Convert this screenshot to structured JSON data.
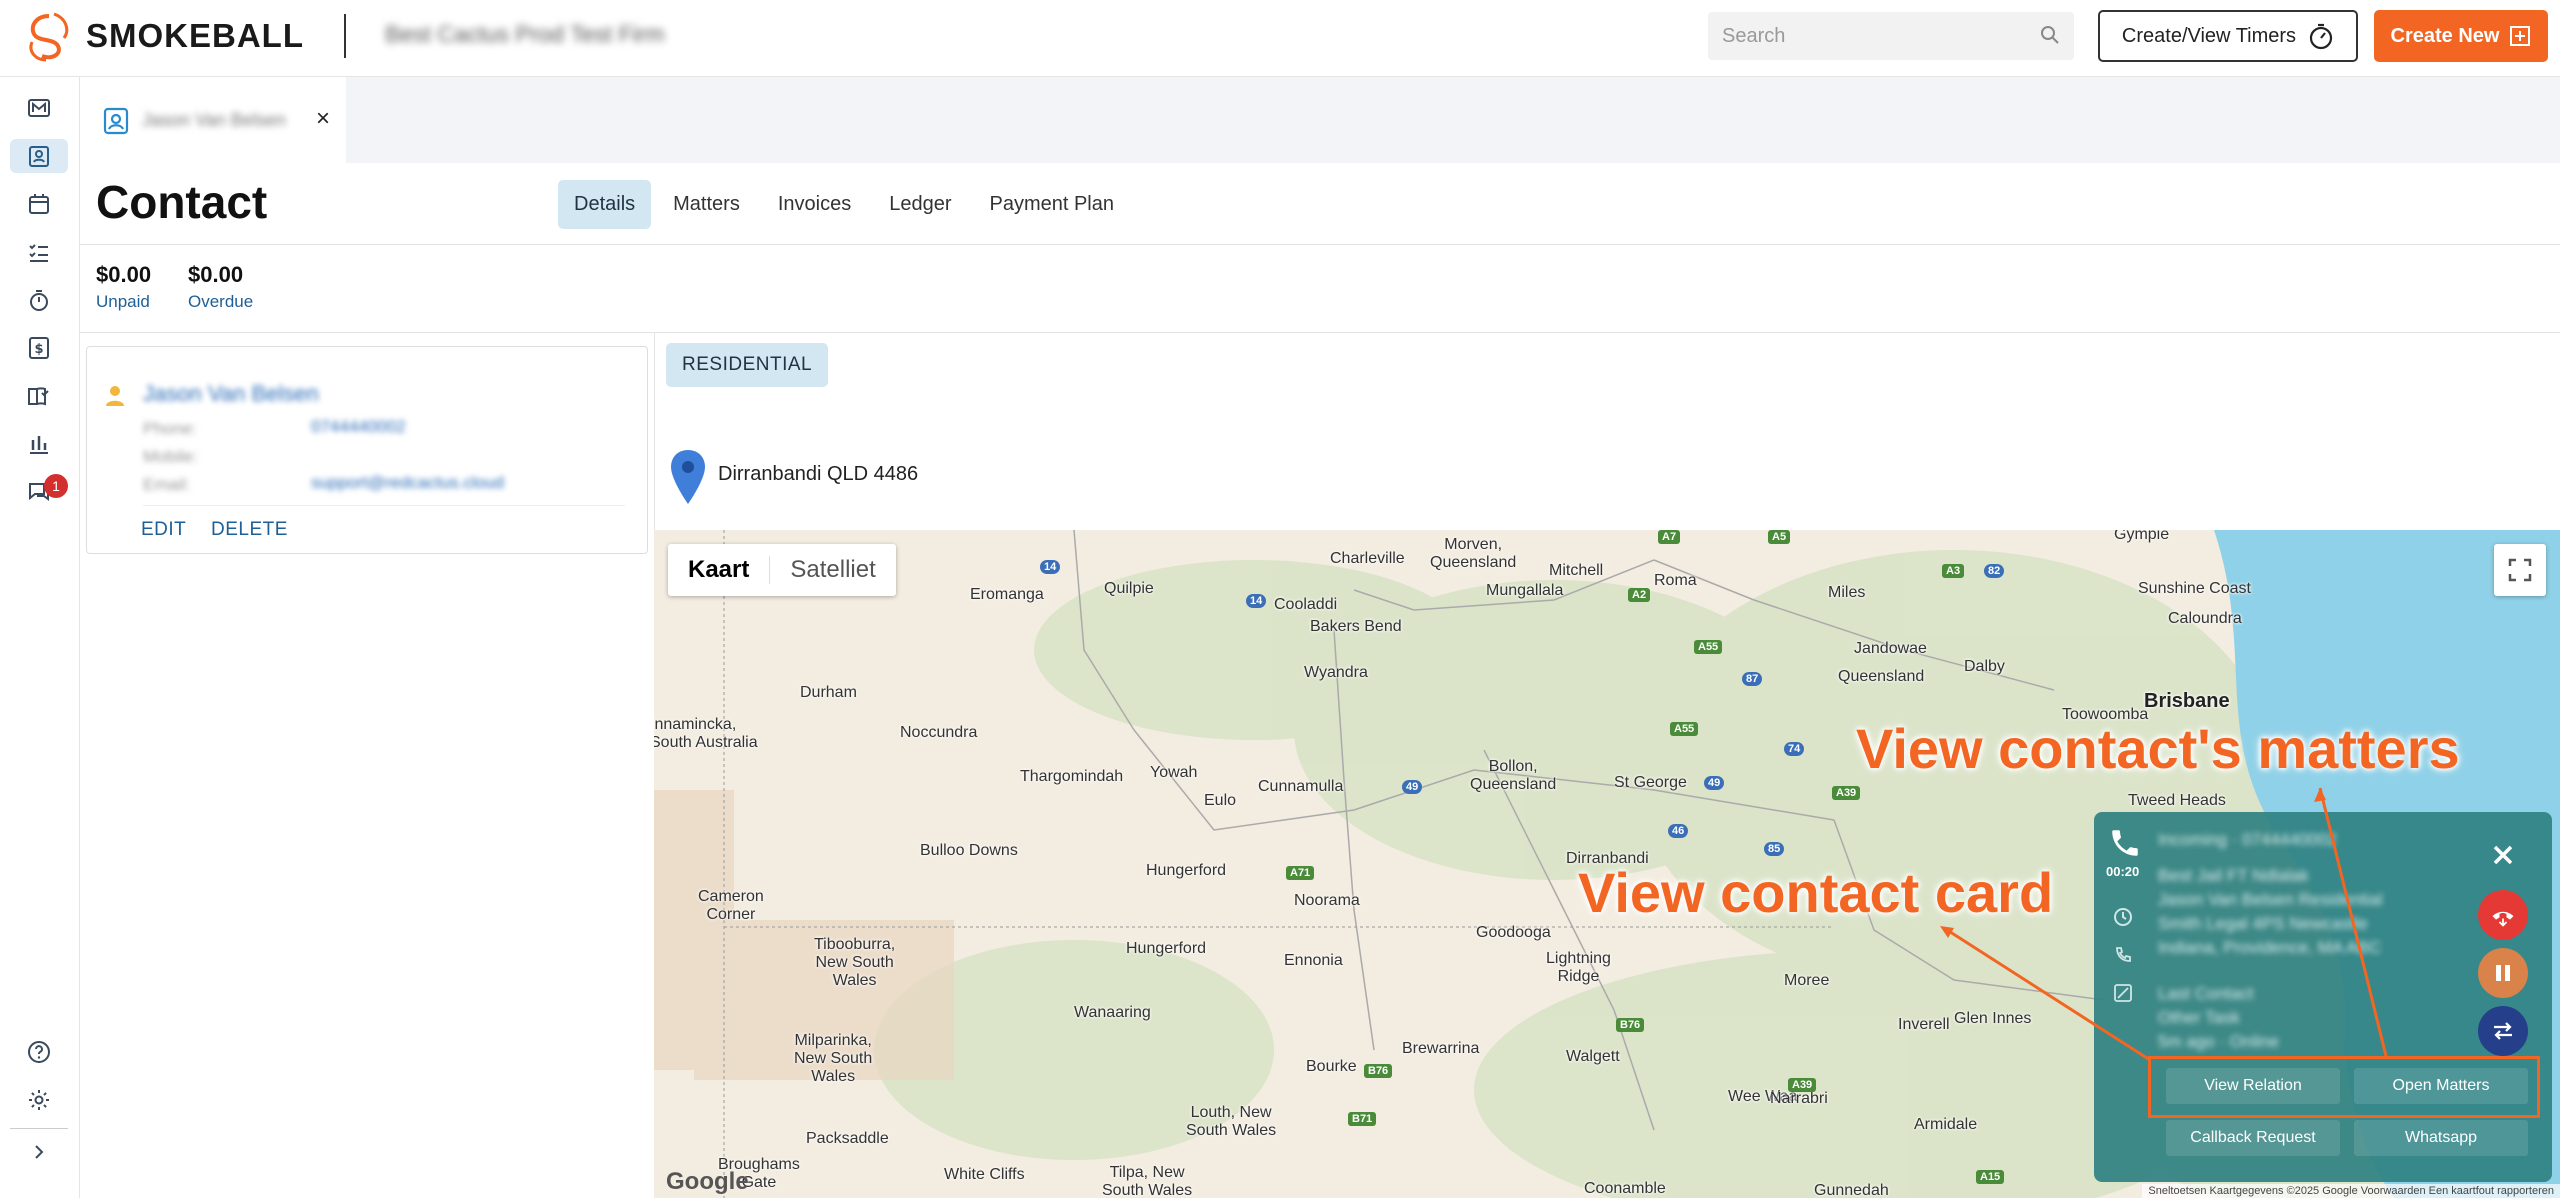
{
  "brand": {
    "name": "SMOKEBALL",
    "firm": "Best Cactus Prod Test Firm",
    "accent": "#f26522"
  },
  "header": {
    "search_placeholder": "Search",
    "timers_label": "Create/View Timers",
    "create_new_label": "Create New"
  },
  "sidebar": {
    "items": [
      "matters-icon",
      "contacts-icon",
      "calendar-icon",
      "tasks-icon",
      "timer-icon",
      "billing-icon",
      "library-icon",
      "reports-icon",
      "communicate-icon"
    ],
    "badge": "1",
    "bottom": [
      "help-icon",
      "settings-icon",
      "expand-icon"
    ]
  },
  "doc_tab": {
    "name": "Jason Van Belsen",
    "close": "×"
  },
  "page": {
    "title": "Contact",
    "tabs": [
      {
        "label": "Details",
        "active": true
      },
      {
        "label": "Matters"
      },
      {
        "label": "Invoices"
      },
      {
        "label": "Ledger"
      },
      {
        "label": "Payment Plan"
      }
    ],
    "unpaid_amount": "$0.00",
    "unpaid_label": "Unpaid",
    "overdue_amount": "$0.00",
    "overdue_label": "Overdue"
  },
  "contact_card": {
    "name": "Jason Van Belsen",
    "phone_label": "Phone:",
    "phone_value": "0744440002",
    "mobile_label": "Mobile:",
    "email_label": "Email:",
    "email_value": "support@redcactus.cloud",
    "edit": "EDIT",
    "delete": "DELETE"
  },
  "details": {
    "chip": "RESIDENTIAL",
    "address": "Dirranbandi QLD 4486"
  },
  "map": {
    "type_map": "Kaart",
    "type_satellite": "Satelliet",
    "google": "Google",
    "copyright": "Sneltoetsen   Kaartgegevens ©2025 Google   Voorwaarden   Een kaartfout rapporteren",
    "places": [
      {
        "name": "Morven,\nQueensland"
      },
      {
        "name": "Charleville"
      },
      {
        "name": "Mitchell"
      },
      {
        "name": "Roma"
      },
      {
        "name": "Gympie"
      },
      {
        "name": "Sunshine Coast"
      },
      {
        "name": "Caloundra"
      },
      {
        "name": "Miles"
      },
      {
        "name": "Eromanga"
      },
      {
        "name": "Quilpie"
      },
      {
        "name": "Cooladdi"
      },
      {
        "name": "Bakers Bend"
      },
      {
        "name": "Mungallala"
      },
      {
        "name": "Dalby"
      },
      {
        "name": "Jandowae"
      },
      {
        "name": "Queensland"
      },
      {
        "name": "Brisbane"
      },
      {
        "name": "Toowoomba"
      },
      {
        "name": "Durham"
      },
      {
        "name": "Wyandra"
      },
      {
        "name": "Innamincka,\nSouth Australia"
      },
      {
        "name": "Noccundra"
      },
      {
        "name": "Thargomindah"
      },
      {
        "name": "Yowah"
      },
      {
        "name": "Eulo"
      },
      {
        "name": "Cunnamulla"
      },
      {
        "name": "Bollon,\nQueensland"
      },
      {
        "name": "St George"
      },
      {
        "name": "Tweed Heads"
      },
      {
        "name": "Bulloo Downs"
      },
      {
        "name": "Hungerford"
      },
      {
        "name": "Dirranbandi"
      },
      {
        "name": "Cameron\nCorner"
      },
      {
        "name": "Noorama"
      },
      {
        "name": "Goodooga"
      },
      {
        "name": "Tibooburra,\nNew South\nWales"
      },
      {
        "name": "Hungerford"
      },
      {
        "name": "Ennonia"
      },
      {
        "name": "Lightning\nRidge"
      },
      {
        "name": "Moree"
      },
      {
        "name": "Glen Innes"
      },
      {
        "name": "Inverell"
      },
      {
        "name": "Milparinka,\nNew South\nWales"
      },
      {
        "name": "Wanaaring"
      },
      {
        "name": "Brewarrina"
      },
      {
        "name": "Walgett"
      },
      {
        "name": "Bourke"
      },
      {
        "name": "Wee Waa"
      },
      {
        "name": "Narrabri"
      },
      {
        "name": "Armidale"
      },
      {
        "name": "Louth, New\nSouth Wales"
      },
      {
        "name": "Packsaddle"
      },
      {
        "name": "Broughams\nGate"
      },
      {
        "name": "White Cliffs"
      },
      {
        "name": "Tilpa, New\nSouth Wales"
      },
      {
        "name": "Coonamble"
      },
      {
        "name": "Gunnedah"
      }
    ]
  },
  "call_widget": {
    "timer": "00:20",
    "info_lines": [
      "Incoming · 0744440002",
      "Best Jail FT Ndlalak",
      "Jason Van Belsen Residential",
      "Smith Legal 4PS Newcastle",
      "Indiana, Providence, MA ABC"
    ],
    "info_lines2": [
      "Last Contact",
      "Other Task",
      "5m ago · Online"
    ],
    "view_relation": "View Relation",
    "open_matters": "Open Matters",
    "callback": "Callback Request",
    "whatsapp": "Whatsapp",
    "colors": {
      "panel": "#2f8282",
      "hangup": "#e53935",
      "pause": "#d9834b",
      "transfer": "#263f8a"
    }
  },
  "annotations": {
    "matters": "View contact's matters",
    "card": "View contact card"
  }
}
